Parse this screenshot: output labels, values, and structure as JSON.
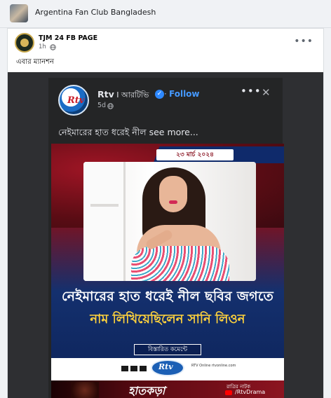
{
  "group": {
    "name": "Argentina Fan Club Bangladesh"
  },
  "post": {
    "page_name": "TJM 24 FB PAGE",
    "time": "1h",
    "more": "•••",
    "text": "এবার ম্যানশন"
  },
  "shared_post": {
    "page_name": "Rtv",
    "page_name_extra": " I আরটিভি",
    "verified": "✓",
    "follow_separator": "·",
    "follow_label": "Follow",
    "time": "5d",
    "more": "•••",
    "close": "✕",
    "caption": "নেইমারের হাত ধরেই নীল see more...",
    "logo_text": "Rtv"
  },
  "graphic": {
    "date": "২৩ মার্চ ২০২৪",
    "headline_1": "নেইমারের হাত ধরেই নীল ছবির জগতে",
    "headline_2": "নাম লিখিয়েছিলেন সানি লিওন",
    "detail_label": "বিস্তারিত কমেন্টে",
    "footer_logo": "Rtv",
    "footer_small": "RTV Online\nrtvonline.com",
    "ad_title": "হাতকড়া",
    "ad_sub": "রাত্রির নাটক",
    "ad_handle": "/RtvDrama"
  },
  "colors": {
    "accent": "#4599ff",
    "headline_yellow": "#ffd23c",
    "brand_red": "#c9202c",
    "dark_bg": "#242526"
  }
}
